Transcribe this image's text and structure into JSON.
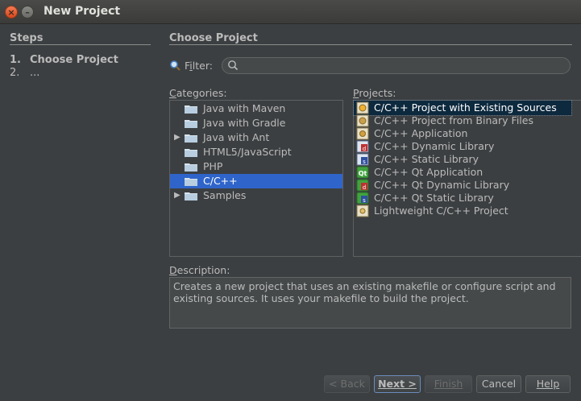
{
  "window": {
    "title": "New Project"
  },
  "steps": {
    "heading": "Steps",
    "items": [
      {
        "num": "1.",
        "label": "Choose Project"
      },
      {
        "num": "2.",
        "label": "..."
      }
    ]
  },
  "main": {
    "heading": "Choose Project"
  },
  "filter": {
    "label_mnemonic": "i",
    "label_pre": "F",
    "label_post": "lter:",
    "value": ""
  },
  "categories": {
    "label_mnemonic": "C",
    "label_rest": "ategories:",
    "items": [
      {
        "label": "Java with Maven",
        "expandable": false
      },
      {
        "label": "Java with Gradle",
        "expandable": false
      },
      {
        "label": "Java with Ant",
        "expandable": true
      },
      {
        "label": "HTML5/JavaScript",
        "expandable": false
      },
      {
        "label": "PHP",
        "expandable": false
      },
      {
        "label": "C/C++",
        "expandable": false,
        "selected": true
      },
      {
        "label": "Samples",
        "expandable": true
      }
    ]
  },
  "projects": {
    "label_mnemonic": "P",
    "label_rest": "rojects:",
    "items": [
      {
        "label": "C/C++ Project with Existing Sources",
        "icon": "existing-sources-icon",
        "selected": true
      },
      {
        "label": "C/C++ Project from Binary Files",
        "icon": "binary-files-icon"
      },
      {
        "label": "C/C++ Application",
        "icon": "cpp-application-icon"
      },
      {
        "label": "C/C++ Dynamic Library",
        "icon": "dynamic-library-icon"
      },
      {
        "label": "C/C++ Static Library",
        "icon": "static-library-icon"
      },
      {
        "label": "C/C++ Qt Application",
        "icon": "qt-application-icon"
      },
      {
        "label": "C/C++ Qt Dynamic Library",
        "icon": "qt-dynamic-library-icon"
      },
      {
        "label": "C/C++ Qt Static Library",
        "icon": "qt-static-library-icon"
      },
      {
        "label": "Lightweight C/C++ Project",
        "icon": "lightweight-project-icon"
      }
    ]
  },
  "description": {
    "label_mnemonic": "D",
    "label_rest": "escription:",
    "text": "Creates a new project that uses an existing makefile or configure script and existing sources. It uses your makefile to build the project."
  },
  "buttons": {
    "back": "< Back",
    "next": "Next >",
    "finish": "Finish",
    "cancel": "Cancel",
    "help": "Help"
  },
  "colors": {
    "background": "#3c3f41",
    "selection": "#2f65ca",
    "text": "#bbbbbb"
  }
}
